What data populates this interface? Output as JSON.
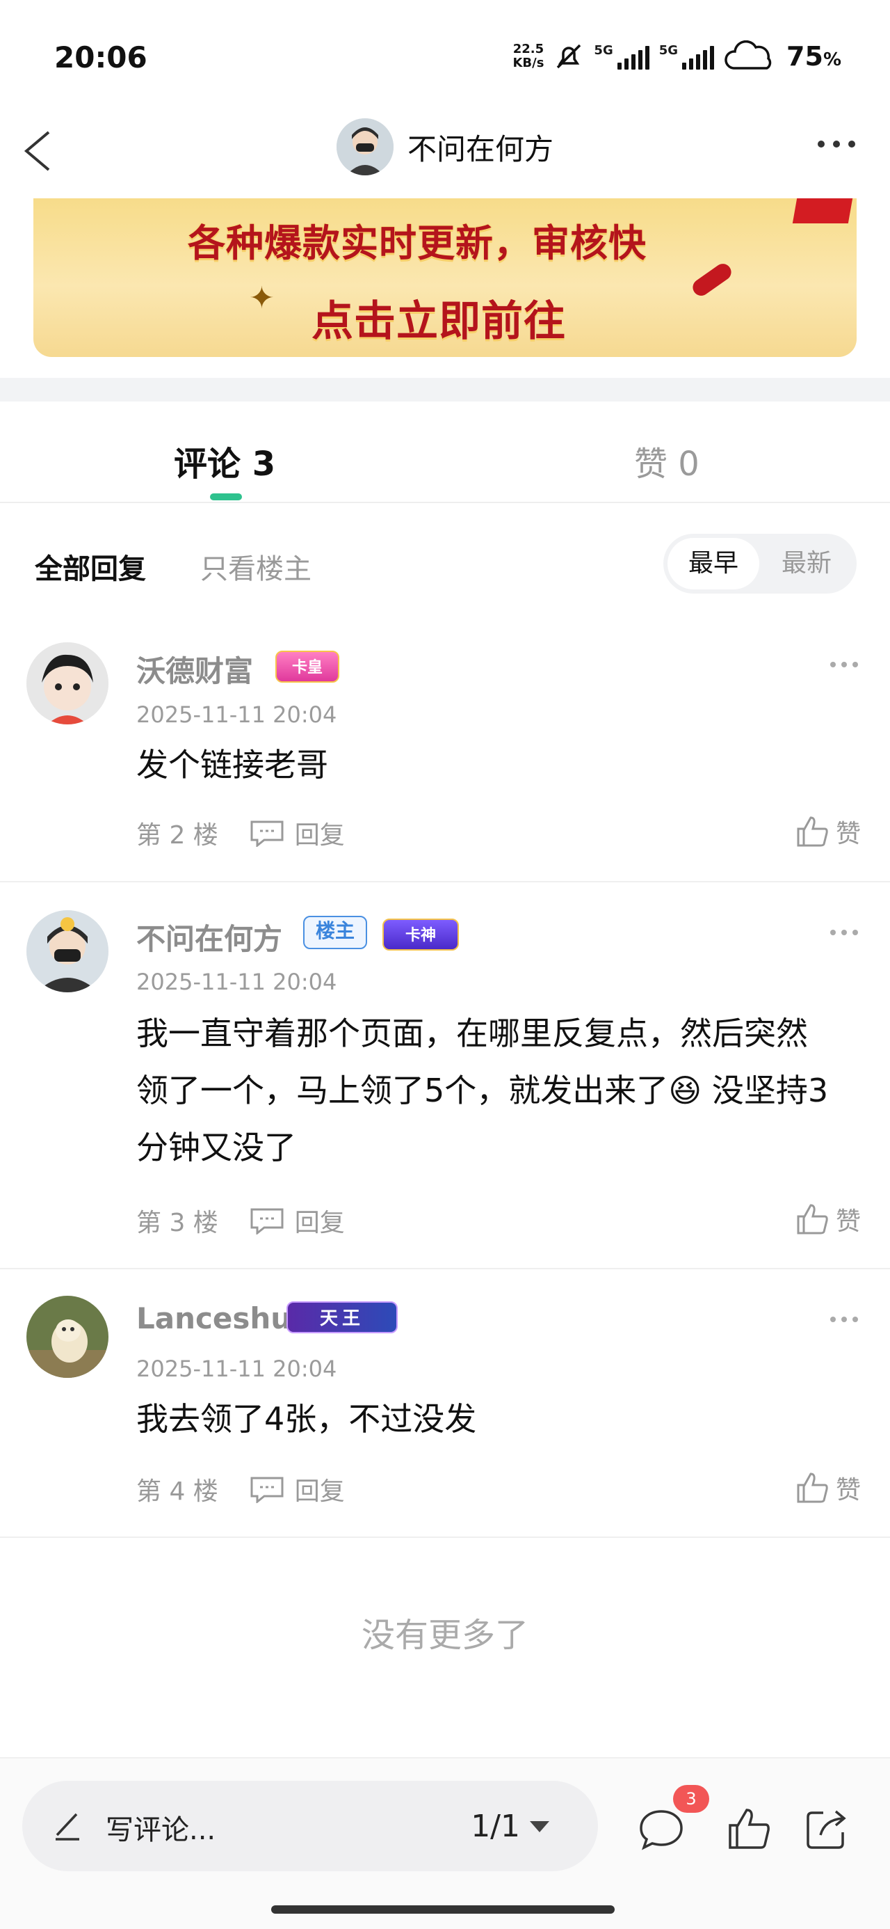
{
  "status_bar": {
    "time": "20:06",
    "net_speed_value": "22.5",
    "net_speed_unit": "KB/s",
    "signal1_label": "5G",
    "signal2_label": "5G",
    "battery_percent": "75",
    "battery_unit": "%",
    "icons": [
      "bell-off-icon",
      "signal-icon",
      "signal-icon",
      "weather-cloud-icon"
    ]
  },
  "header": {
    "title": "不问在何方",
    "back_icon": "chevron-left-icon",
    "more_icon": "more-dots-icon"
  },
  "banner": {
    "line1": "各种爆款实时更新，审核快",
    "line2": "点击立即前往",
    "star": "✦"
  },
  "tabs": [
    {
      "label": "评论 3",
      "active": true
    },
    {
      "label": "赞 0",
      "active": false
    }
  ],
  "filters": {
    "all": "全部回复",
    "owner_only": "只看楼主",
    "sort_earliest": "最早",
    "sort_latest": "最新"
  },
  "comments": [
    {
      "name": "沃德财富",
      "badge": "卡皇",
      "time": "2025-11-11 20:04",
      "text": "发个链接老哥",
      "floor": "第 2 楼",
      "reply": "回复",
      "like": "赞"
    },
    {
      "name": "不问在何方",
      "owner_badge": "楼主",
      "badge": "卡神",
      "time": "2025-11-11 20:04",
      "text": "我一直守着那个页面，在哪里反复点，然后突然领了一个，马上领了5个，就发出来了😆 没坚持3分钟又没了",
      "floor": "第 3 楼",
      "reply": "回复",
      "like": "赞"
    },
    {
      "name": "Lanceshu",
      "badge": "天王",
      "time": "2025-11-11 20:04",
      "text": "我去领了4张，不过没发",
      "floor": "第 4 楼",
      "reply": "回复",
      "like": "赞"
    }
  ],
  "no_more": "没有更多了",
  "bottom_bar": {
    "placeholder": "写评论...",
    "pager": "1/1",
    "comment_count": "3",
    "icons": [
      "pen-icon",
      "comment-bubble-icon",
      "thumbs-up-icon",
      "share-icon"
    ]
  },
  "colors": {
    "accent": "#2ec28e",
    "banner_text": "#b4141c",
    "badge_red": "#f25656"
  }
}
